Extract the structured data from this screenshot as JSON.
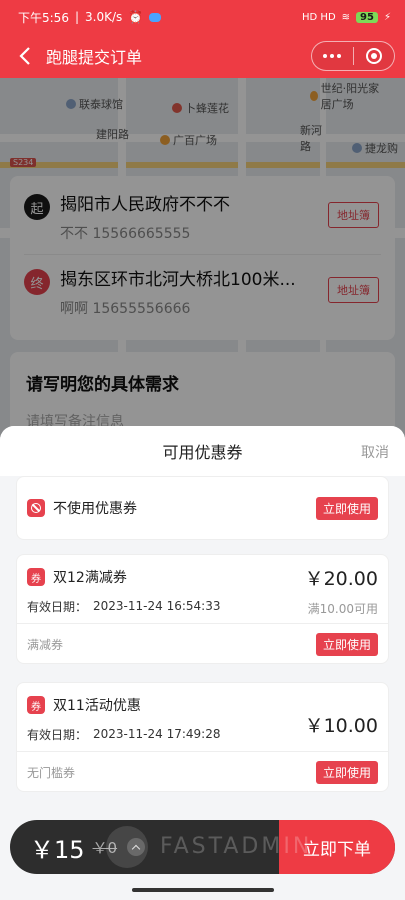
{
  "status_bar": {
    "time": "下午5:56",
    "speed": "3.0K/s",
    "battery": "95",
    "signal": "HD HD"
  },
  "nav": {
    "title": "跑腿提交订单"
  },
  "map": {
    "pois": [
      "联泰球馆",
      "卜蜂莲花",
      "建阳路",
      "广百广场",
      "新河路",
      "世纪·阳光家居广场",
      "捷龙购"
    ],
    "road_tag": "S234"
  },
  "address": {
    "start_badge": "起",
    "start_address": "揭阳市人民政府不不不",
    "start_contact": "不不 15566665555",
    "end_badge": "终",
    "end_address": "揭东区环市北河大桥北100米...",
    "end_contact": "啊啊 15655556666",
    "book_label": "地址簿"
  },
  "need": {
    "title": "请写明您的具体需求",
    "placeholder": "请填写备注信息"
  },
  "coupon_sheet": {
    "title": "可用优惠券",
    "cancel": "取消",
    "use_label": "立即使用",
    "no_coupon": "不使用优惠券",
    "coupon_icon": "券",
    "coupons": [
      {
        "name": "双12满减券",
        "amount": "￥20.00",
        "expiry_label": "有效日期：",
        "expiry": "2023-11-24 16:54:33",
        "condition": "满10.00可用",
        "type": "满减券"
      },
      {
        "name": "双11活动优惠",
        "amount": "￥10.00",
        "expiry_label": "有效日期：",
        "expiry": "2023-11-24 17:49:28",
        "condition": "",
        "type": "无门槛券"
      }
    ]
  },
  "bottom_bar": {
    "price": "￥15",
    "old_price": "￥0",
    "watermark": "FASTADMIN",
    "submit": "立即下单"
  },
  "colors": {
    "brand": "#ee3b44",
    "dark": "#2d2d2d"
  }
}
